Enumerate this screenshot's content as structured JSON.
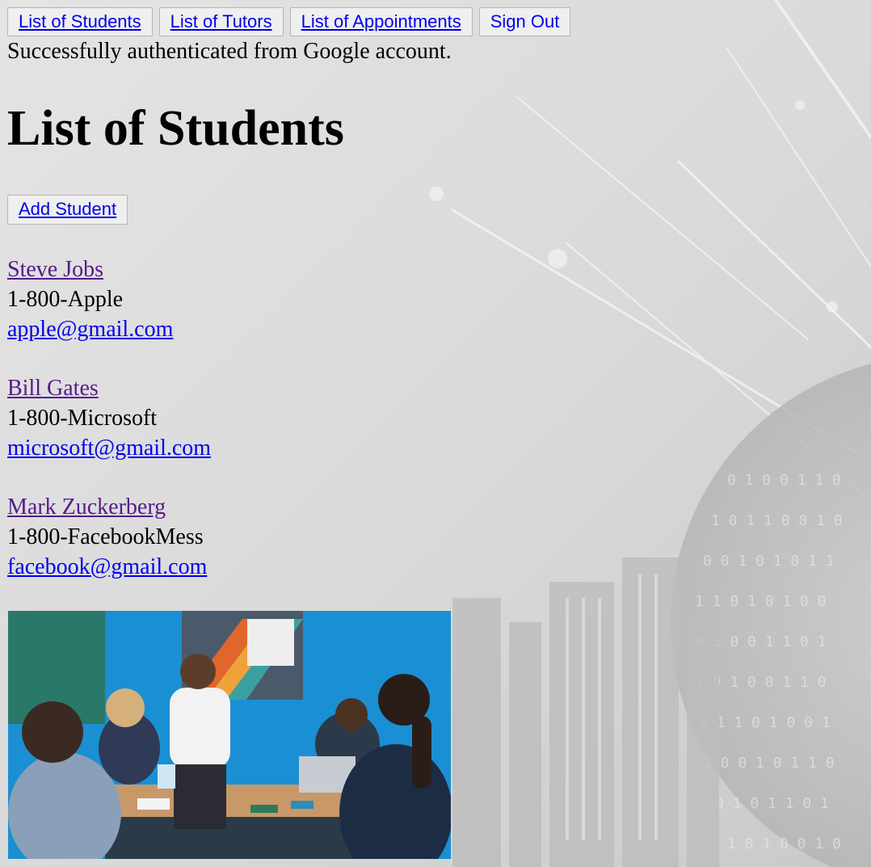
{
  "nav": {
    "students": "List of Students",
    "tutors": "List of Tutors",
    "appointments": "List of Appointments",
    "sign_out": "Sign Out"
  },
  "status_message": "Successfully authenticated from Google account.",
  "page_title": "List of Students",
  "add_student_label": "Add Student",
  "students": [
    {
      "name": "Steve Jobs",
      "phone": "1-800-Apple",
      "email": "apple@gmail.com"
    },
    {
      "name": "Bill Gates",
      "phone": "1-800-Microsoft",
      "email": "microsoft@gmail.com"
    },
    {
      "name": "Mark Zuckerberg",
      "phone": "1-800-FacebookMess",
      "email": "facebook@gmail.com"
    }
  ],
  "colors": {
    "link": "#0000ee",
    "visited_link": "#551a8b",
    "button_bg": "#efefef",
    "background": "#dcdcdc"
  }
}
